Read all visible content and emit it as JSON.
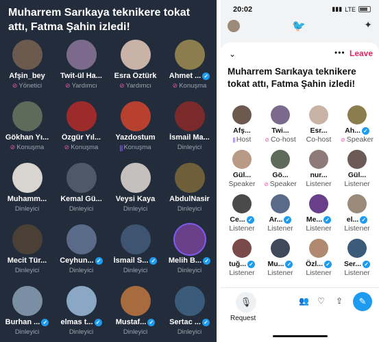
{
  "title": "Muharrem Sarıkaya teknikere tokat attı, Fatma Şahin izledi!",
  "left_participants": [
    {
      "name": "Afşin_bey",
      "role": "Yönetici",
      "verified": false,
      "role_icon": "mic-off",
      "bg": "#6d5a4e"
    },
    {
      "name": "Twit-ül Ha...",
      "role": "Yardımcı",
      "verified": false,
      "role_icon": "mic-off",
      "bg": "#7b6a8c"
    },
    {
      "name": "Esra Öztürk",
      "role": "Yardımcı",
      "verified": false,
      "role_icon": "mic-off",
      "bg": "#c9b3a6"
    },
    {
      "name": "Ahmet ...",
      "role": "Konuşma",
      "verified": true,
      "role_icon": "mic-off",
      "bg": "#8c7d4e"
    },
    {
      "name": "Gökhan Yı...",
      "role": "Konuşma",
      "verified": false,
      "role_icon": "mic-off",
      "bg": "#5e6a5a"
    },
    {
      "name": "Özgür Yıl...",
      "role": "Konuşma",
      "verified": false,
      "role_icon": "mic-off",
      "bg": "#9e2b2b"
    },
    {
      "name": "Yazdostum",
      "role": "Konuşma",
      "verified": false,
      "role_icon": "speaking",
      "bg": "#b8402f"
    },
    {
      "name": "İsmail Ma...",
      "role": "Dinleyici",
      "verified": false,
      "role_icon": "",
      "bg": "#7a2a2a"
    },
    {
      "name": "Muhamm...",
      "role": "Dinleyici",
      "verified": false,
      "role_icon": "",
      "bg": "#d8d4cf"
    },
    {
      "name": "Kemal Gü...",
      "role": "Dinleyici",
      "verified": false,
      "role_icon": "",
      "bg": "#4e5866"
    },
    {
      "name": "Veysi Kaya",
      "role": "Dinleyici",
      "verified": false,
      "role_icon": "",
      "bg": "#c4c0bd"
    },
    {
      "name": "AbdulNasir",
      "role": "Dinleyici",
      "verified": false,
      "role_icon": "",
      "bg": "#6f5e3a"
    },
    {
      "name": "Mecit Tür...",
      "role": "Dinleyici",
      "verified": false,
      "role_icon": "",
      "bg": "#4a4035"
    },
    {
      "name": "Ceyhun...",
      "role": "Dinleyici",
      "verified": true,
      "role_icon": "",
      "bg": "#5a6b8a"
    },
    {
      "name": "İsmail S...",
      "role": "Dinleyici",
      "verified": true,
      "role_icon": "",
      "bg": "#3e5470"
    },
    {
      "name": "Melih B...",
      "role": "Dinleyici",
      "verified": true,
      "role_icon": "",
      "bg": "#6a3f8a",
      "ring": true
    },
    {
      "name": "Burhan ...",
      "role": "Dinleyici",
      "verified": true,
      "role_icon": "",
      "bg": "#7a8fa3"
    },
    {
      "name": "elmas t...",
      "role": "Dinleyici",
      "verified": true,
      "role_icon": "",
      "bg": "#8aa7c4"
    },
    {
      "name": "Mustaf...",
      "role": "Dinleyici",
      "verified": true,
      "role_icon": "",
      "bg": "#a86b3e"
    },
    {
      "name": "Sertac ...",
      "role": "Dinleyici",
      "verified": true,
      "role_icon": "",
      "bg": "#3c5a7a"
    }
  ],
  "right": {
    "status": {
      "time": "20:02",
      "network": "LTE"
    },
    "leave_label": "Leave",
    "participants": [
      {
        "name": "Afş...",
        "role": "Host",
        "verified": false,
        "role_icon": "speaking",
        "bg": "#6d5a4e"
      },
      {
        "name": "Twi...",
        "role": "Co-host",
        "verified": false,
        "role_icon": "mic-off",
        "bg": "#7b6a8c"
      },
      {
        "name": "Esr...",
        "role": "Co-host",
        "verified": false,
        "role_icon": "",
        "bg": "#c9b3a6"
      },
      {
        "name": "Ah...",
        "role": "Speaker",
        "verified": true,
        "role_icon": "mic-off",
        "bg": "#8c7d4e"
      },
      {
        "name": "Gül...",
        "role": "Speaker",
        "verified": false,
        "role_icon": "",
        "bg": "#b89a86"
      },
      {
        "name": "Gö...",
        "role": "Speaker",
        "verified": false,
        "role_icon": "mic-off",
        "bg": "#5e6a5a"
      },
      {
        "name": "nur...",
        "role": "Listener",
        "verified": false,
        "role_icon": "",
        "bg": "#8e7a78"
      },
      {
        "name": "Gül...",
        "role": "Listener",
        "verified": false,
        "role_icon": "",
        "bg": "#6b5a55"
      },
      {
        "name": "Ce...",
        "role": "Listener",
        "verified": true,
        "role_icon": "",
        "bg": "#4a4a4a"
      },
      {
        "name": "Ar...",
        "role": "Listener",
        "verified": true,
        "role_icon": "",
        "bg": "#5a6b8a"
      },
      {
        "name": "Me...",
        "role": "Listener",
        "verified": true,
        "role_icon": "",
        "bg": "#6a3f8a"
      },
      {
        "name": "el...",
        "role": "Listener",
        "verified": true,
        "role_icon": "",
        "bg": "#9a8a7a"
      },
      {
        "name": "tuğ...",
        "role": "Listener",
        "verified": true,
        "role_icon": "",
        "bg": "#7a4a4a"
      },
      {
        "name": "Mu...",
        "role": "Listener",
        "verified": true,
        "role_icon": "",
        "bg": "#3e4a5a"
      },
      {
        "name": "Özl...",
        "role": "Listener",
        "verified": true,
        "role_icon": "",
        "bg": "#b08a70"
      },
      {
        "name": "Ser...",
        "role": "Listener",
        "verified": true,
        "role_icon": "",
        "bg": "#3c5a7a"
      }
    ],
    "request_label": "Request"
  },
  "colors": {
    "accent": "#1d9bf0",
    "leave": "#e0245e",
    "dark_bg": "#232c3b",
    "mic_off": "#e35dad",
    "speaking": "#8a63ff"
  }
}
